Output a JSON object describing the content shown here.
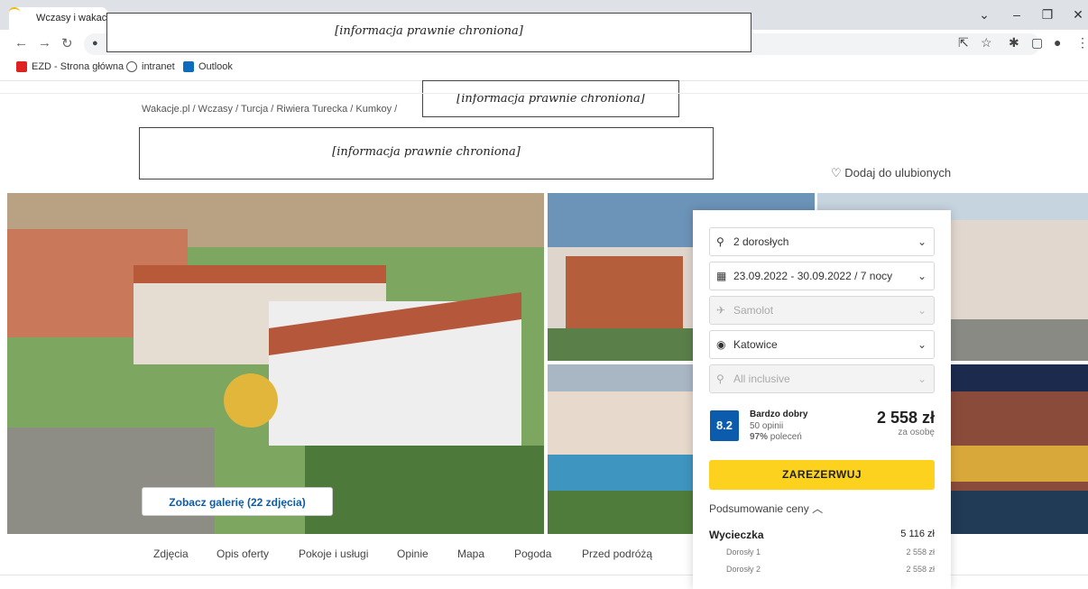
{
  "browser": {
    "tab_title": "Wczasy i wakacje z",
    "bookmarks": [
      "EZD - Strona główna",
      "intranet",
      "Outlook"
    ]
  },
  "redaction_text": "[informacja prawnie chroniona]",
  "breadcrumb": "Wakacje.pl / Wczasy / Turcja / Riwiera Turecka / Kumkoy /",
  "favorite_label": "Dodaj do ulubionych",
  "booking": {
    "guests": "2 dorosłych",
    "dates": "23.09.2022 - 30.09.2022 / 7 nocy",
    "transport": "Samolot",
    "departure": "Katowice",
    "board": "All inclusive",
    "rating_score": "8.2",
    "rating_label": "Bardzo dobry",
    "reviews": "50 opinii",
    "recommend_pct": "97%",
    "recommend_label": "poleceń",
    "price": "2 558 zł",
    "price_unit": "za osobę",
    "book_button": "ZAREZERWUJ",
    "summary_label": "Podsumowanie ceny",
    "trip_label": "Wycieczka",
    "trip_total": "5 116 zł",
    "lines": [
      {
        "label": "Dorosły 1",
        "value": "2 558 zł"
      },
      {
        "label": "Dorosły 2",
        "value": "2 558 zł"
      }
    ]
  },
  "gallery_button": "Zobacz galerię (22 zdjęcia)",
  "page_tabs": [
    "Zdjęcia",
    "Opis oferty",
    "Pokoje i usługi",
    "Opinie",
    "Mapa",
    "Pogoda",
    "Przed podróżą"
  ],
  "colors": {
    "accent": "#0b5cad",
    "button": "#fcd21e"
  }
}
